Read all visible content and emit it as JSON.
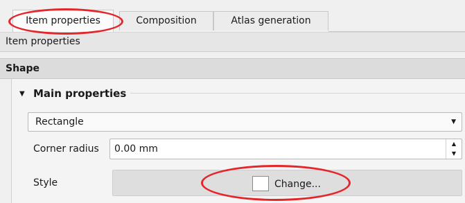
{
  "tabs": [
    {
      "label": "Item properties",
      "active": true
    },
    {
      "label": "Composition",
      "active": false
    },
    {
      "label": "Atlas generation",
      "active": false
    }
  ],
  "section_header": "Item properties",
  "subsection_header": "Shape",
  "group": {
    "title": "Main properties",
    "expanded": true
  },
  "shape_combo": {
    "value": "Rectangle"
  },
  "corner_radius": {
    "label": "Corner radius",
    "value": "0.00 mm"
  },
  "style": {
    "label": "Style",
    "button_label": "Change...",
    "swatch_color": "#ffffff"
  },
  "annotation_color": "#e4262b"
}
